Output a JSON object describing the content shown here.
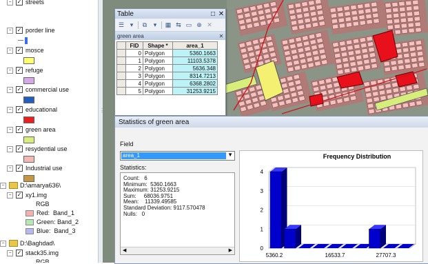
{
  "toc": {
    "layers": [
      {
        "name": "streets",
        "checked": true
      },
      {
        "name": "porder line",
        "checked": true,
        "symbol_color": "#3a6ee8",
        "symbol": "line"
      },
      {
        "name": "mosce",
        "checked": true,
        "symbol_color": "#ffff70"
      },
      {
        "name": "refuge",
        "checked": true,
        "symbol_color": "#d6a8e8"
      },
      {
        "name": "commercial use",
        "checked": true,
        "symbol_color": "#1f5fc0"
      },
      {
        "name": "educational",
        "checked": true,
        "symbol_color": "#e82020"
      },
      {
        "name": "green area",
        "checked": true,
        "symbol_color": "#d8ee7a"
      },
      {
        "name": "resydential use",
        "checked": true,
        "symbol_color": "#f4b8b4"
      },
      {
        "name": "Industrial use",
        "checked": true,
        "symbol_color": "#c8963e"
      }
    ],
    "folder1": "D:\\amarya636\\",
    "raster1": {
      "name": "xy1.img",
      "rgb_label": "RGB",
      "bands": [
        {
          "label": "Red:  Band_1",
          "color": "#f2b0b0"
        },
        {
          "label": "Green: Band_2",
          "color": "#b4e8b4"
        },
        {
          "label": "Blue:  Band_3",
          "color": "#b8b8f0"
        }
      ]
    },
    "folder2": "D:\\Baghdad\\",
    "raster2": {
      "name": "stack35.img",
      "rgb_label": "RGB"
    }
  },
  "table_window": {
    "title": "Table",
    "subtitle": "green area",
    "columns": [
      "FID",
      "Shape *",
      "area_1"
    ],
    "rows": [
      {
        "fid": "0",
        "shape": "Polygon",
        "area": "5360.1663"
      },
      {
        "fid": "1",
        "shape": "Polygon",
        "area": "11103.5378"
      },
      {
        "fid": "2",
        "shape": "Polygon",
        "area": "5636.348"
      },
      {
        "fid": "3",
        "shape": "Polygon",
        "area": "8314.7213"
      },
      {
        "fid": "4",
        "shape": "Polygon",
        "area": "6368.2802"
      },
      {
        "fid": "5",
        "shape": "Polygon",
        "area": "31253.9215"
      }
    ]
  },
  "stats_dialog": {
    "title": "Statistics of green area",
    "field_label": "Field",
    "field_value": "area_1",
    "statistics_label": "Statistics:",
    "lines": [
      "Count:   6",
      "Minimum:  5360.1663",
      "Maximum: 31253.9215",
      "Sum:     68036.9751",
      "Mean:    11339.49585",
      "Standard Deviation: 9117.570478",
      "Nulls:   0"
    ]
  },
  "chart_data": {
    "type": "bar",
    "title": "Frequency Distribution",
    "tick_labels_x": [
      "5360.2",
      "16533.7",
      "27707.3"
    ],
    "ylim": [
      0,
      4
    ],
    "yticks": [
      "0",
      "1",
      "2",
      "3",
      "4"
    ],
    "values": [
      4,
      1,
      0,
      0,
      0,
      0,
      0,
      1,
      0,
      0
    ],
    "bar_color": "#0000cc",
    "grid": true
  }
}
